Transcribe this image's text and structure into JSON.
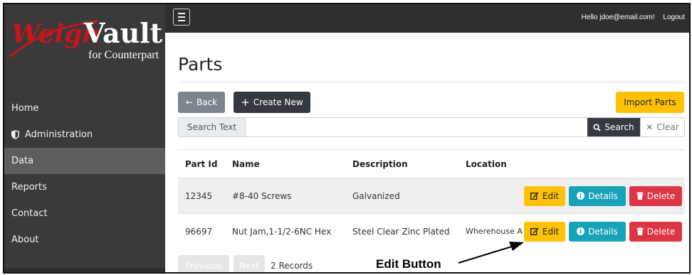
{
  "logo": {
    "brand_weigh": "Weigh",
    "brand_vault": "Vault",
    "tagline": "for Counterpart"
  },
  "sidebar": {
    "items": [
      {
        "label": "Home",
        "icon": ""
      },
      {
        "label": "Administration",
        "icon": "shield-icon"
      },
      {
        "label": "Data",
        "icon": "",
        "active": true
      },
      {
        "label": "Reports",
        "icon": ""
      },
      {
        "label": "Contact",
        "icon": ""
      },
      {
        "label": "About",
        "icon": ""
      }
    ]
  },
  "topbar": {
    "greeting": "Hello jdoe@email.com!",
    "logout": "Logout"
  },
  "page": {
    "title": "Parts",
    "back_label": "Back",
    "create_label": "Create New",
    "import_label": "Import Parts"
  },
  "search": {
    "label": "Search Text",
    "value": "",
    "placeholder": "",
    "search_label": "Search",
    "clear_label": "Clear"
  },
  "table": {
    "headers": [
      "Part Id",
      "Name",
      "Description",
      "Location"
    ],
    "rows": [
      {
        "part_id": "12345",
        "name": "#8-40 Screws",
        "description": "Galvanized",
        "location": ""
      },
      {
        "part_id": "96697",
        "name": "Nut Jam,1-1/2-6NC Hex",
        "description": "Steel Clear Zinc Plated",
        "location": "Wherehouse A"
      }
    ],
    "row_actions": {
      "edit": "Edit",
      "details": "Details",
      "delete": "Delete"
    }
  },
  "pager": {
    "previous": "Previous",
    "next": "Next",
    "records": "2 Records"
  },
  "annotation": {
    "label": "Edit Button"
  },
  "colors": {
    "sidebar_bg": "#3a3a3a",
    "topbar_bg": "#2f2f2f",
    "logo_red": "#c4161c",
    "warning": "#ffc107",
    "info": "#17a2b8",
    "danger": "#dc3545"
  }
}
